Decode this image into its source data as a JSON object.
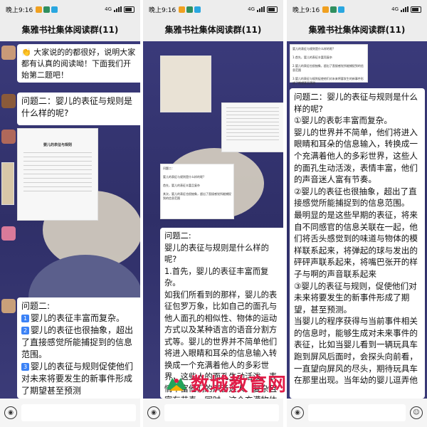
{
  "status": {
    "time": "晚上9:16",
    "signal": "4G"
  },
  "chat_title": "集雅书社集体阅读群(11)",
  "panel1": {
    "msg1": "👏 大家说的的都很好，说明大家都有认真的阅读呦！下面我们开始第二题吧！",
    "msg2": "问题二：婴儿的表征与规则是什么样的呢?",
    "doc_title": "婴儿的表征与规则",
    "msg3_lines": [
      "问题二:",
      "婴儿的表征丰富而复杂。",
      "婴儿的表征也很抽象，超出了直接感觉所能捕捉到的信息范围。",
      "婴儿的表征与规则促使他们对未来将要发生的新事件形成了期望甚至预测"
    ]
  },
  "panel2": {
    "card_title": "问题二：",
    "card_lines": [
      "婴儿的表征与规则是什么样的呢?",
      "首先，婴儿的表征丰富且复杂",
      "其次，婴儿的表征也很抽象，超出了直接感觉所能捕捉到的信息范围",
      "最后婴儿的表征与规则，促使他们对未来将要发生的新事件形成了期望，甚至预测。"
    ],
    "msg_lines": [
      "问题二:",
      "婴儿的表征与规则是什么样的呢?",
      "1.首先，婴儿的表征丰富而复杂。",
      "如我们所看到的那样，婴儿的表征包罗万象，比如自己的面孔与他人面孔的相似性、物体的运动方式以及某种语言的语音分割方式等。婴儿的世界并不简单他们将进入眼睛和耳朵的信息输入转换成一个充满着他人的多彩世界，这些人的面孔生动活泼、表情丰富他们的声音迷人、复杂且富有节奏。同时，这个充满物体运动方式的多彩世界。"
    ]
  },
  "panel3": {
    "top_lines": [
      "婴儿的表征与规则是什么样的呢?",
      "1.首先，婴儿的表征丰富而复杂",
      "2.婴儿的表征也很抽象，超出了直接感觉所能捕捉到的信息范围",
      "3.婴儿的表征与规则促使他们对未来将要发生的新事件形成了期望甚至预测"
    ],
    "msg_lines": [
      "问题二：婴儿的表征与规则是什么样的呢?",
      "①婴儿的表彰丰富而复杂。",
      "婴儿的世界并不简单，他们将进入眼睛和耳朵的信息输入，转换成一个充满着他人的多彩世界，这些人的面孔生动活泼，表情丰富，他们的声音迷人富有节奏。",
      "②婴儿的表征也很抽象，超出了直接感觉所能捕捉到的信息范围。",
      "最明显的是这些早期的表征，将来自不同感官的信息关联在一起，他们将舌头感觉到的味道与物体的模样联系起来，将弹起的球与发出的砰砰声联系起来，将嘴巴张开的样子与啊的声音联系起来",
      "③婴儿的表征与规则，促使他们对未来将要发生的新事件形成了期望，甚至预测。",
      "当婴儿的程序获得与当前事件相关的信息时，能够生成对未来事件的表征，比如当婴儿看到一辆玩具车跑到屏风后面时，会探头向前看，一直望向屏风的尽头，期待玩具车在那里出现。当年幼的婴儿逗弄他"
    ]
  },
  "watermark": "数城教育网",
  "colors": {
    "chat_bg": "#34346f",
    "bubble": "#ffffff",
    "accent_num": "#3b82f6",
    "watermark": "#e11d48"
  }
}
